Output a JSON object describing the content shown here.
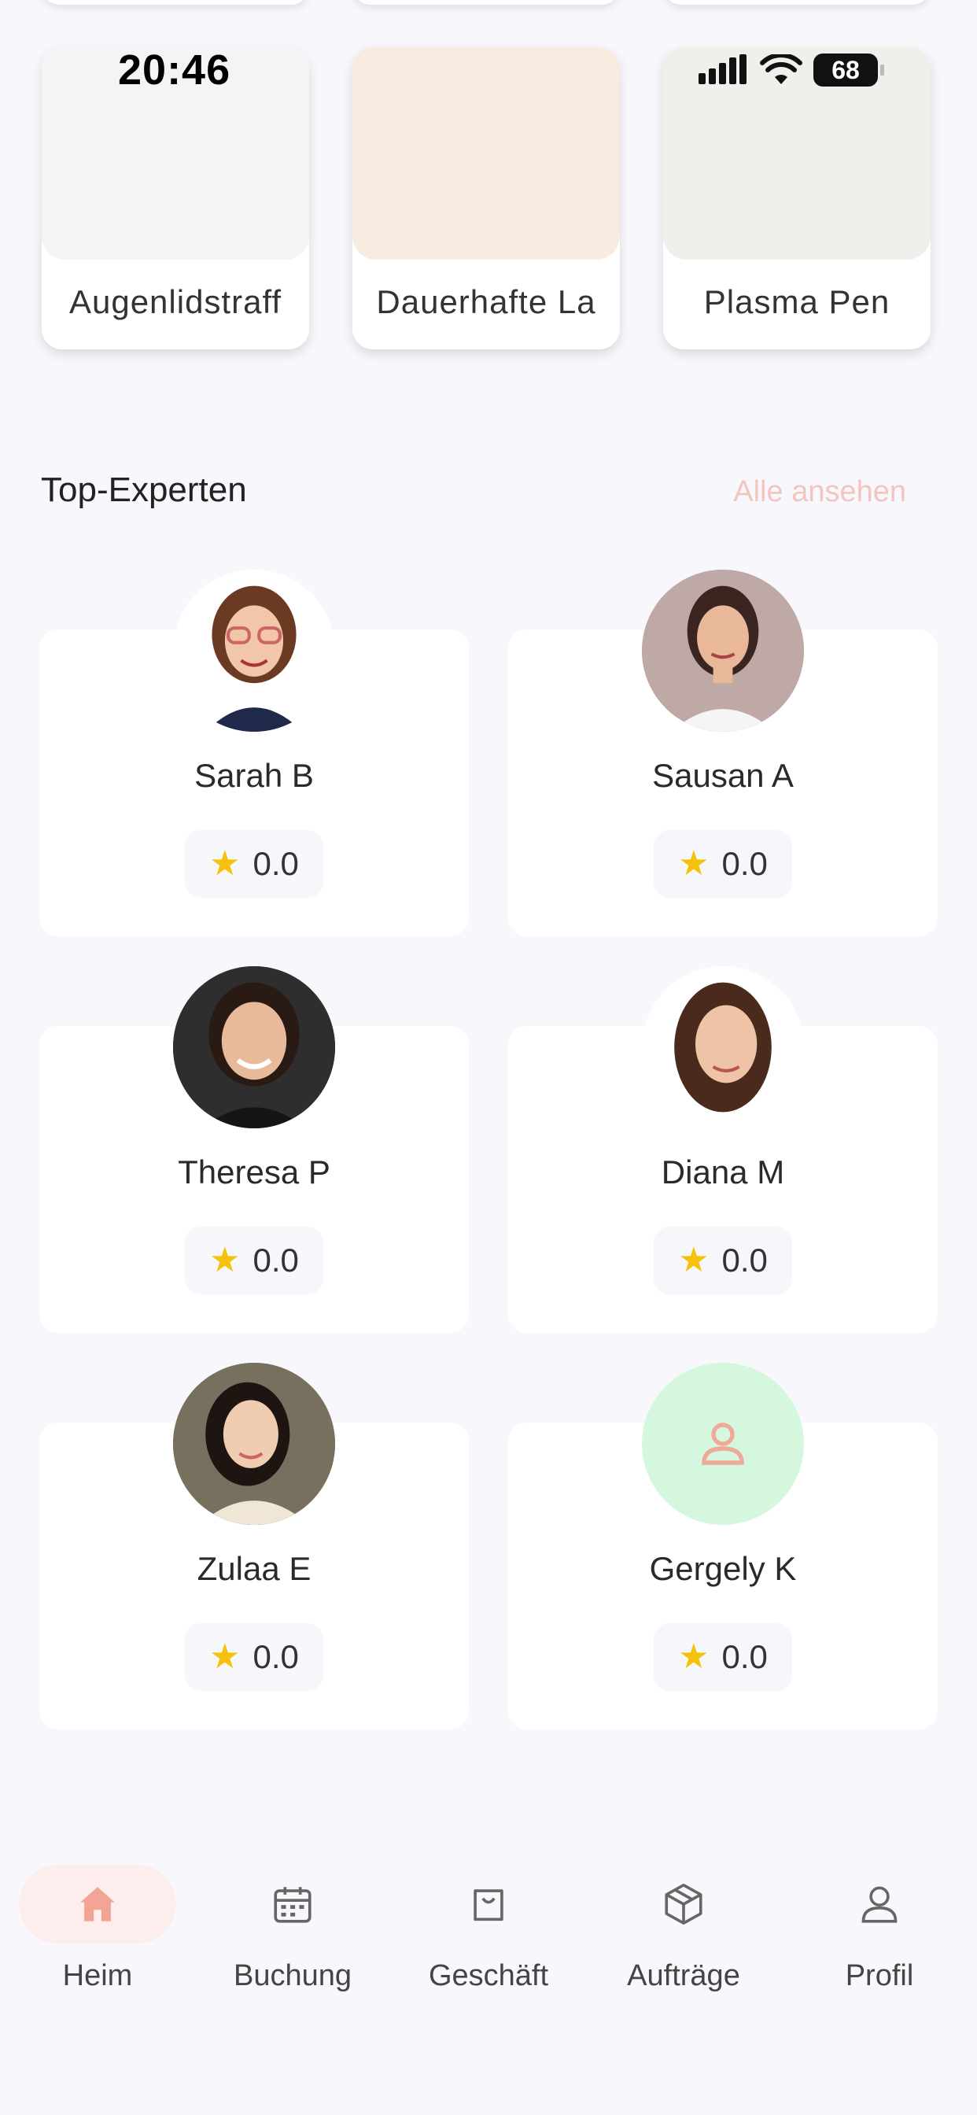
{
  "status_bar": {
    "time": "20:46",
    "battery": "68"
  },
  "categories": [
    {
      "label": "Augenlidstraff",
      "color": "#f4f4f4"
    },
    {
      "label": "Dauerhafte La",
      "color": "#f8ece0"
    },
    {
      "label": "Plasma Pen",
      "color": "#efefec"
    }
  ],
  "section": {
    "title": "Top-Experten",
    "see_all": "Alle ansehen"
  },
  "experts": [
    {
      "name": "Sarah B",
      "rating": "0.0"
    },
    {
      "name": "Sausan A",
      "rating": "0.0"
    },
    {
      "name": "Theresa P",
      "rating": "0.0"
    },
    {
      "name": "Diana M",
      "rating": "0.0"
    },
    {
      "name": "Zulaa E",
      "rating": "0.0"
    },
    {
      "name": "Gergely K",
      "rating": "0.0"
    }
  ],
  "nav": [
    {
      "label": "Heim",
      "icon": "home-icon",
      "active": true
    },
    {
      "label": "Buchung",
      "icon": "calendar-icon"
    },
    {
      "label": "Geschäft",
      "icon": "shopping-bag-icon"
    },
    {
      "label": "Aufträge",
      "icon": "package-icon"
    },
    {
      "label": "Profil",
      "icon": "user-icon"
    }
  ],
  "colors": {
    "accent": "#f2a595",
    "star": "#f4c20d",
    "placeholder_avatar": "#d4f7de"
  }
}
